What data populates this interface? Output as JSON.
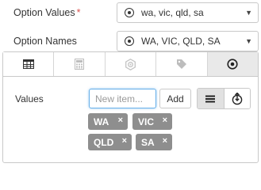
{
  "fields": {
    "option_values": {
      "label": "Option Values",
      "required_mark": "*",
      "value": "wa, vic, qld, sa"
    },
    "option_names": {
      "label": "Option Names",
      "value": "WA, VIC, QLD, SA"
    }
  },
  "tabs": [
    {
      "icon": "table-icon",
      "active": false
    },
    {
      "icon": "calculator-icon",
      "active": false
    },
    {
      "icon": "settings-hexagon-icon",
      "active": false
    },
    {
      "icon": "tag-icon",
      "active": false
    },
    {
      "icon": "radio-icon",
      "active": true
    }
  ],
  "values_editor": {
    "label": "Values",
    "placeholder": "New item...",
    "add_label": "Add",
    "tags": [
      "WA",
      "VIC",
      "QLD",
      "SA"
    ],
    "remove_glyph": "×",
    "view_modes": [
      {
        "icon": "list-icon",
        "active": true
      },
      {
        "icon": "sort-icon",
        "active": false
      }
    ]
  },
  "colors": {
    "tag_background": "#8e8e8e",
    "focus_border": "#66afe9",
    "required": "#d9534f",
    "active_tab": "#e9e9e9"
  }
}
